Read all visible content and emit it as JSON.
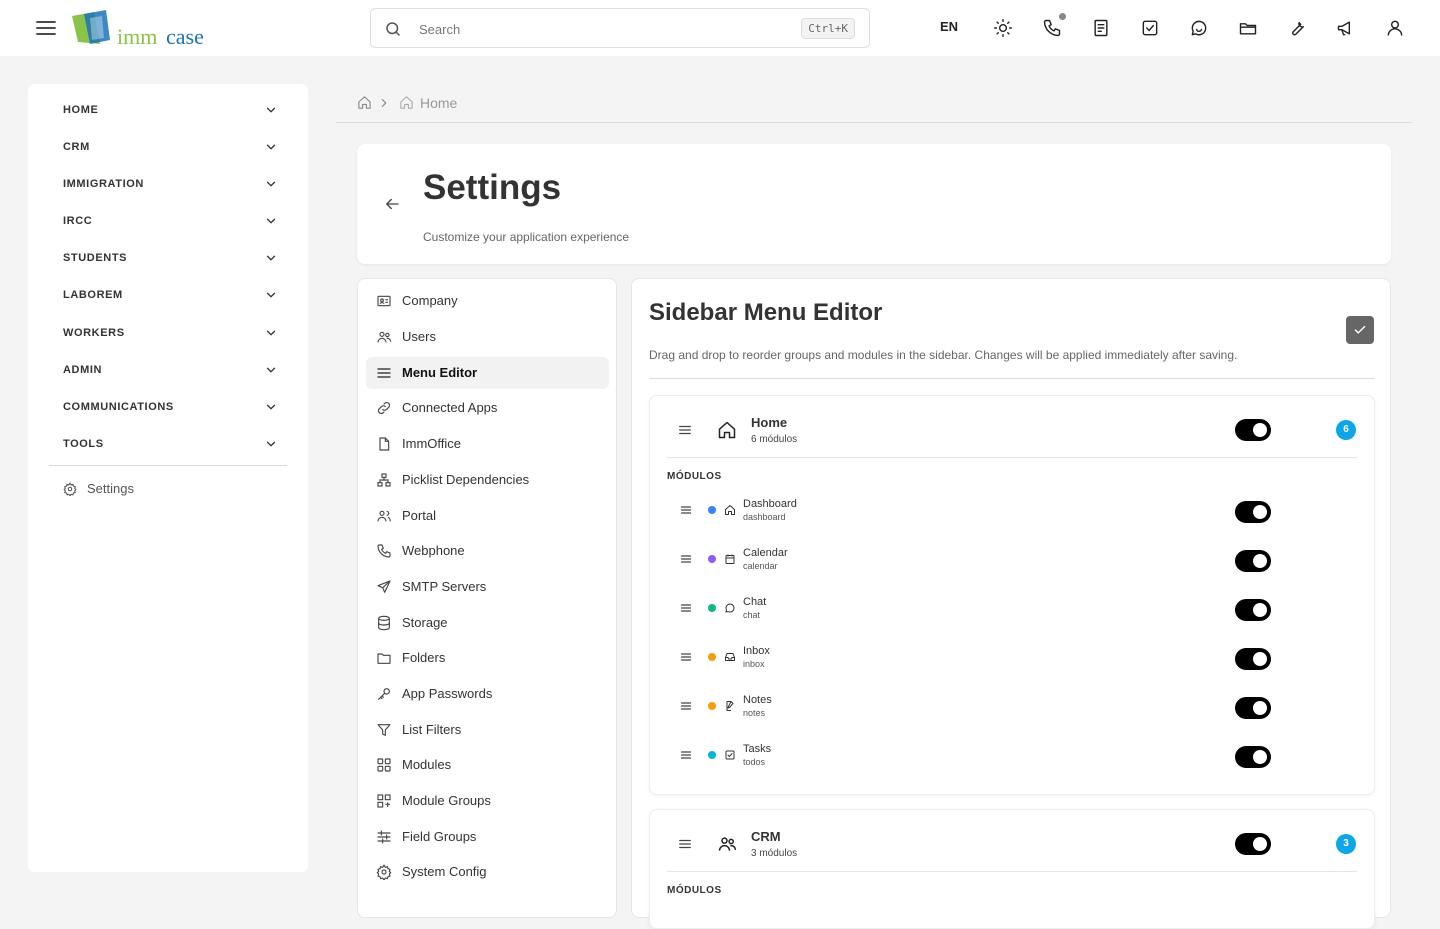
{
  "topbar": {
    "logo": {
      "word1": "imm",
      "word2": "case"
    },
    "search": {
      "placeholder": "Search",
      "shortcut": "Ctrl+K"
    },
    "language": "EN",
    "icons": [
      "sun-icon",
      "phone-icon",
      "notes-icon",
      "tasks-icon",
      "chat-icon",
      "folder-icon",
      "wrench-icon",
      "megaphone-icon",
      "user-icon"
    ]
  },
  "sidebar": {
    "groups": [
      {
        "label": "HOME"
      },
      {
        "label": "CRM"
      },
      {
        "label": "IMMIGRATION"
      },
      {
        "label": "IRCC"
      },
      {
        "label": "STUDENTS"
      },
      {
        "label": "LABOREM"
      },
      {
        "label": "WORKERS"
      },
      {
        "label": "ADMIN"
      },
      {
        "label": "COMMUNICATIONS"
      },
      {
        "label": "TOOLS"
      }
    ],
    "settings_label": "Settings"
  },
  "breadcrumb": {
    "current": "Home"
  },
  "header": {
    "title": "Settings",
    "subtitle": "Customize your application experience"
  },
  "settings_nav": {
    "items": [
      {
        "label": "Company",
        "icon": "id-card-icon"
      },
      {
        "label": "Users",
        "icon": "users-icon"
      },
      {
        "label": "Menu Editor",
        "icon": "menu-icon",
        "active": true
      },
      {
        "label": "Connected Apps",
        "icon": "link-icon"
      },
      {
        "label": "ImmOffice",
        "icon": "file-icon"
      },
      {
        "label": "Picklist Dependencies",
        "icon": "hierarchy-icon"
      },
      {
        "label": "Portal",
        "icon": "portal-users-icon"
      },
      {
        "label": "Webphone",
        "icon": "phone-icon"
      },
      {
        "label": "SMTP Servers",
        "icon": "send-icon"
      },
      {
        "label": "Storage",
        "icon": "database-icon"
      },
      {
        "label": "Folders",
        "icon": "folder-icon"
      },
      {
        "label": "App Passwords",
        "icon": "key-icon"
      },
      {
        "label": "List Filters",
        "icon": "filter-icon"
      },
      {
        "label": "Modules",
        "icon": "grid-icon"
      },
      {
        "label": "Module Groups",
        "icon": "module-groups-icon"
      },
      {
        "label": "Field Groups",
        "icon": "sliders-icon"
      },
      {
        "label": "System Config",
        "icon": "gear-icon"
      }
    ]
  },
  "editor": {
    "title": "Sidebar Menu Editor",
    "description": "Drag and drop to reorder groups and modules in the sidebar. Changes will be applied immediately after saving.",
    "groups": [
      {
        "name": "Home",
        "count_label": "6 módulos",
        "badge": "6",
        "enabled": true,
        "modules_label": "MÓDULOS",
        "modules": [
          {
            "name": "Dashboard",
            "key": "dashboard",
            "color": "#3b82f6",
            "icon": "home-icon",
            "enabled": true
          },
          {
            "name": "Calendar",
            "key": "calendar",
            "color": "#8b5cf6",
            "icon": "calendar-icon",
            "enabled": true
          },
          {
            "name": "Chat",
            "key": "chat",
            "color": "#10b981",
            "icon": "chat-icon",
            "enabled": true
          },
          {
            "name": "Inbox",
            "key": "inbox",
            "color": "#f59e0b",
            "icon": "inbox-icon",
            "enabled": true
          },
          {
            "name": "Notes",
            "key": "notes",
            "color": "#f59e0b",
            "icon": "note-edit-icon",
            "enabled": true
          },
          {
            "name": "Tasks",
            "key": "todos",
            "color": "#06b6d4",
            "icon": "checkbox-icon",
            "enabled": true
          }
        ]
      },
      {
        "name": "CRM",
        "count_label": "3 módulos",
        "badge": "3",
        "enabled": true,
        "modules_label": "MÓDULOS",
        "modules": []
      }
    ]
  }
}
